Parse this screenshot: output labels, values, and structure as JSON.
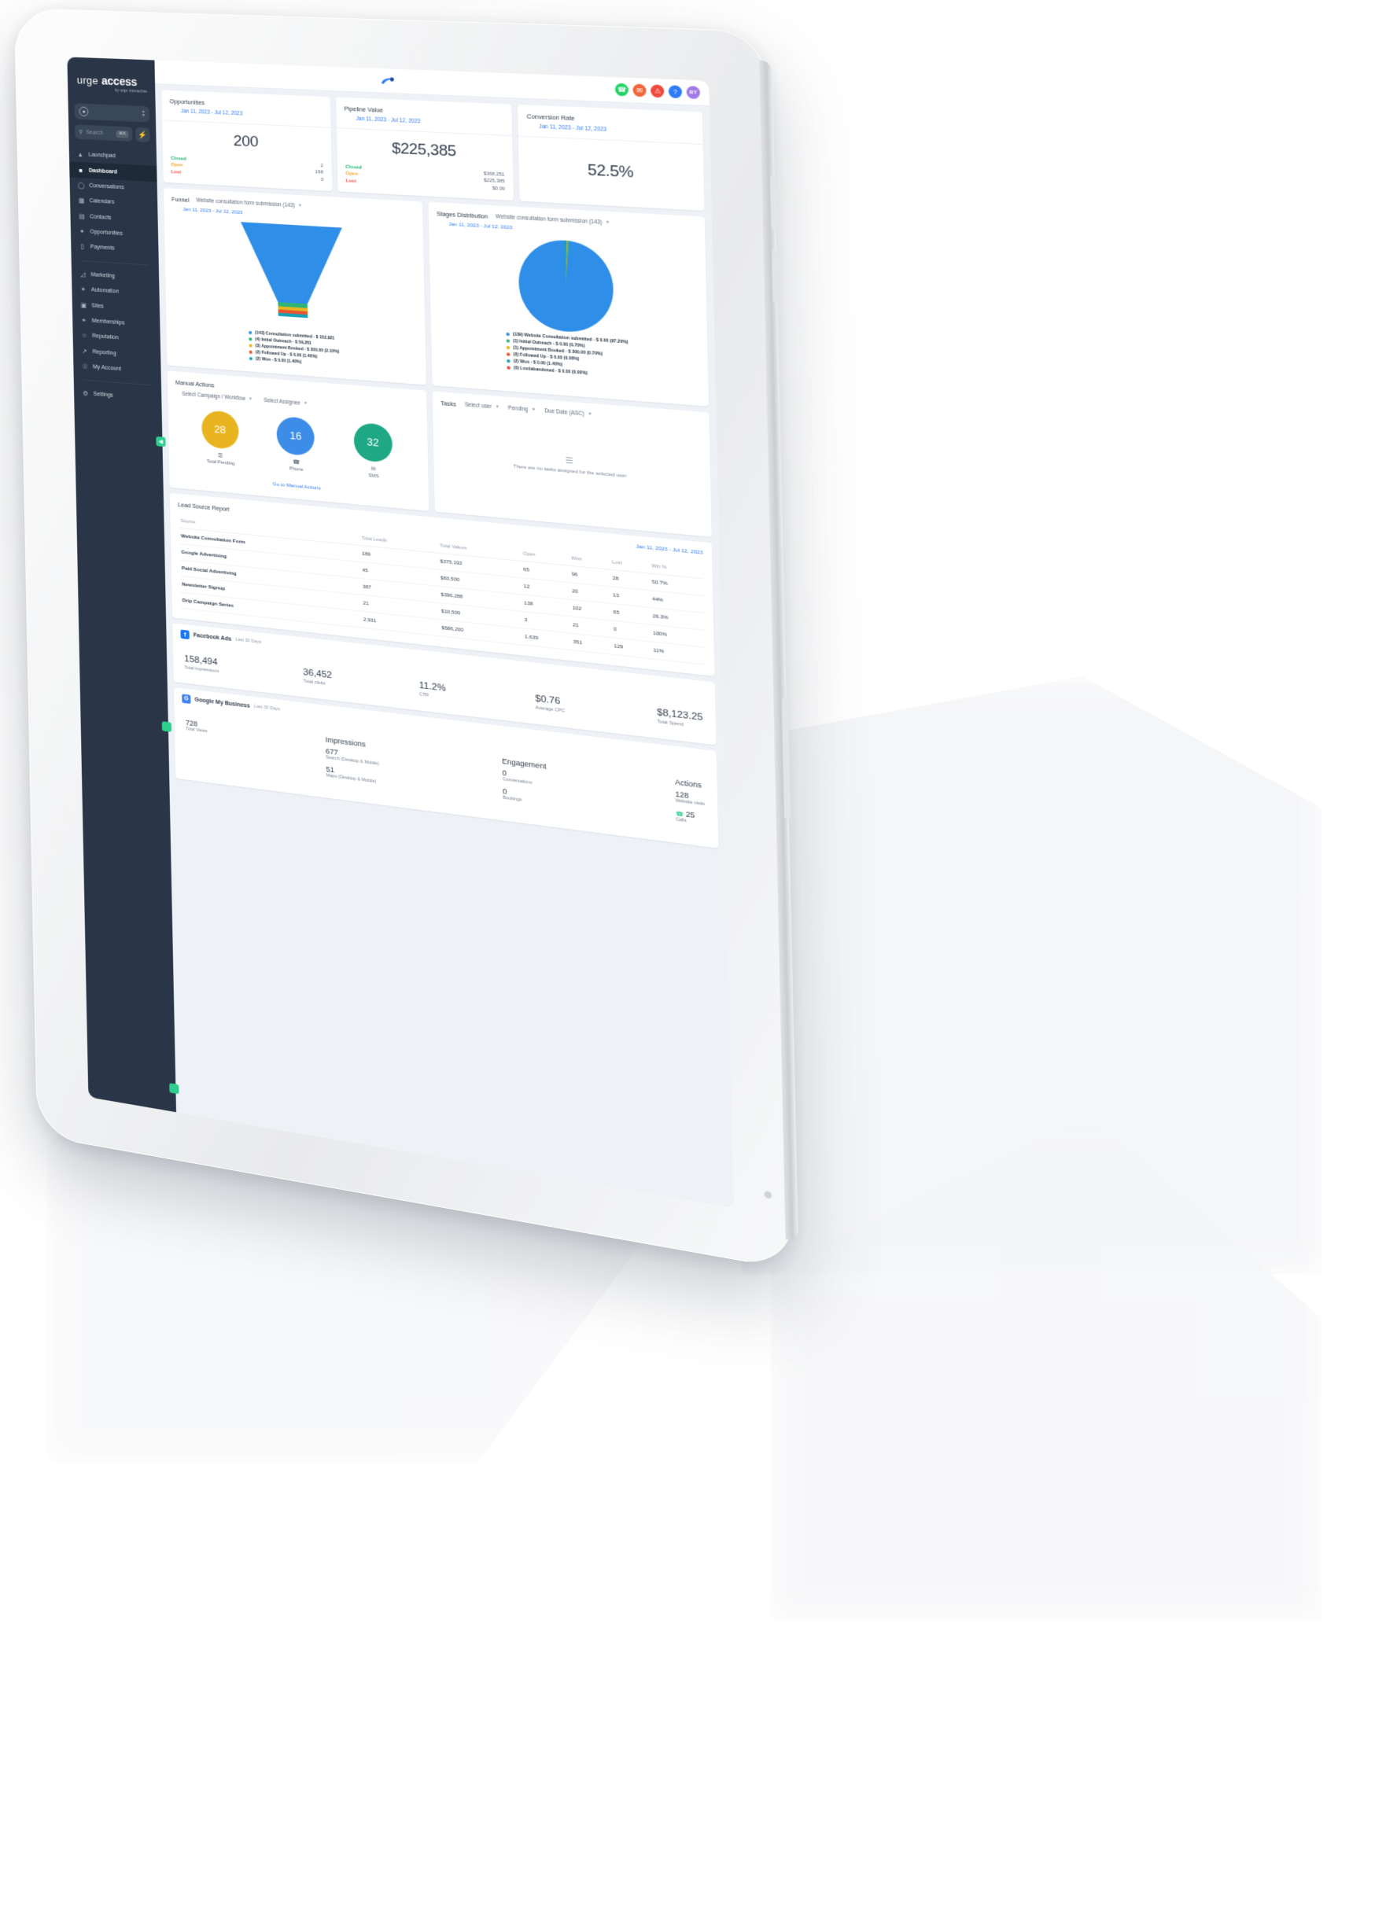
{
  "brand": {
    "name_part1": "urge",
    "name_part2": "access",
    "tagline": "by urge interactive"
  },
  "sidebar": {
    "search_placeholder": "Search",
    "search_shortcut": "⌘K",
    "items": [
      {
        "label": "Launchpad",
        "icon": "rocket-icon"
      },
      {
        "label": "Dashboard",
        "icon": "grid-icon"
      },
      {
        "label": "Conversations",
        "icon": "chat-icon"
      },
      {
        "label": "Calendars",
        "icon": "calendar-icon"
      },
      {
        "label": "Contacts",
        "icon": "contacts-icon"
      },
      {
        "label": "Opportunities",
        "icon": "opportunities-icon"
      },
      {
        "label": "Payments",
        "icon": "payments-icon"
      }
    ],
    "items2": [
      {
        "label": "Marketing",
        "icon": "megaphone-icon"
      },
      {
        "label": "Automation",
        "icon": "automation-icon"
      },
      {
        "label": "Sites",
        "icon": "sites-icon"
      },
      {
        "label": "Memberships",
        "icon": "memberships-icon"
      },
      {
        "label": "Reputation",
        "icon": "star-icon"
      },
      {
        "label": "Reporting",
        "icon": "reporting-icon"
      },
      {
        "label": "My Account",
        "icon": "account-icon"
      }
    ],
    "items3": [
      {
        "label": "Settings",
        "icon": "gear-icon"
      }
    ],
    "active": "Dashboard"
  },
  "topbar": {
    "avatar_initials": "BY"
  },
  "kpis": [
    {
      "title": "Opportunities",
      "date": "Jan 11, 2023 - Jul 12, 2023",
      "value": "200",
      "stats": [
        {
          "label": "Closed",
          "value": "2"
        },
        {
          "label": "Open",
          "value": "198"
        },
        {
          "label": "Lost",
          "value": "0"
        }
      ]
    },
    {
      "title": "Pipeline Value",
      "date": "Jan 11, 2023 - Jul 12, 2023",
      "value": "$225,385",
      "stats": [
        {
          "label": "Closed",
          "value": "$368,251"
        },
        {
          "label": "Open",
          "value": "$225,385"
        },
        {
          "label": "Lost",
          "value": "$0.00"
        }
      ]
    },
    {
      "title": "Conversion Rate",
      "date": "Jan 11, 2023 - Jul 12, 2023",
      "value": "52.5%",
      "stats": []
    }
  ],
  "funnel": {
    "title": "Funnel",
    "selector": "Website consultation form submission (143)",
    "date": "Jan 11, 2023 - Jul 12, 2023"
  },
  "stages": {
    "title": "Stages Distribution",
    "selector": "Website consultation form submission (143)",
    "date": "Jan 11, 2023 - Jul 12, 2023"
  },
  "manual_actions": {
    "title": "Manual Actions",
    "campaign_dropdown": "Select Campaign / Workflow",
    "assignee_dropdown": "Select Assignee",
    "link": "Go to Manual Actions",
    "circles": [
      {
        "value": "28",
        "label": "Total Pending",
        "icon": "list-icon",
        "color": "#e8b520"
      },
      {
        "value": "16",
        "label": "Phone",
        "icon": "phone-icon",
        "color": "#3b8de8"
      },
      {
        "value": "32",
        "label": "SMS",
        "icon": "sms-icon",
        "color": "#1fa886"
      }
    ]
  },
  "tasks": {
    "title": "Tasks",
    "user_dropdown": "Select user",
    "status_dropdown": "Pending",
    "sort_dropdown": "Due Date (ASC)",
    "empty_text": "There are no tasks assigned for the selected user"
  },
  "lead_source": {
    "title": "Lead Source Report",
    "date": "Jan 11, 2023 - Jul 12, 2023",
    "columns": [
      "Source",
      "Total Leads",
      "Total Values",
      "Open",
      "Won",
      "Lost",
      "Win %"
    ],
    "rows": [
      [
        "Website Consultation Form",
        "189",
        "$375,193",
        "65",
        "96",
        "28",
        "50.7%"
      ],
      [
        "Google Advertising",
        "45",
        "$83,500",
        "12",
        "20",
        "13",
        "44%"
      ],
      [
        "Paid Social Advertising",
        "387",
        "$396,288",
        "138",
        "102",
        "65",
        "26.3%"
      ],
      [
        "Newsletter Signup",
        "21",
        "$10,500",
        "3",
        "21",
        "0",
        "100%"
      ],
      [
        "Drip Campaign Series",
        "2,931",
        "$586,200",
        "1,639",
        "351",
        "129",
        "11%"
      ]
    ]
  },
  "facebook": {
    "title": "Facebook Ads",
    "subtitle": "Last 30 Days",
    "stats": [
      {
        "value": "158,494",
        "label": "Total impressions"
      },
      {
        "value": "36,452",
        "label": "Total clicks"
      },
      {
        "value": "11.2%",
        "label": "CTR"
      },
      {
        "value": "$0.76",
        "label": "Average CPC"
      },
      {
        "value": "$8,123.25",
        "label": "Total Spend"
      }
    ]
  },
  "gmb": {
    "title": "Google My Business",
    "subtitle": "Last 30 Days",
    "total_views_value": "728",
    "total_views_label": "Total Views",
    "impressions_header": "Impressions",
    "impressions": [
      {
        "value": "677",
        "label": "Search (Desktop & Mobile)"
      },
      {
        "value": "51",
        "label": "Maps (Desktop & Mobile)"
      }
    ],
    "engagement_header": "Engagement",
    "engagement": [
      {
        "value": "0",
        "label": "Conversations"
      },
      {
        "value": "0",
        "label": "Bookings"
      }
    ],
    "actions_header": "Actions",
    "actions": [
      {
        "value": "128",
        "label": "Website visits"
      },
      {
        "value": "25",
        "label": "Calls"
      }
    ]
  },
  "chart_data": [
    {
      "type": "funnel",
      "title": "Funnel",
      "legend_position": "bottom",
      "categories": [
        "(143) Consultation submitted",
        "(4) Initial Outreach",
        "(3) Appointment Booked",
        "(2) Followed Up",
        "(2) Won"
      ],
      "counts": [
        143,
        4,
        3,
        2,
        2
      ],
      "values": [
        "$ 152,921",
        "$ 59,261",
        "$ 300.00",
        "$ 0.00",
        "$ 0.00"
      ],
      "percents": [
        null,
        null,
        "2.10%",
        "1.40%",
        "1.40%"
      ],
      "colors": [
        "#2f8fe8",
        "#2fb673",
        "#e8b520",
        "#e8562f",
        "#17a2b8"
      ],
      "labels": [
        "(143) Consultation submitted - $ 152,921",
        "(4) Initial Outreach - $ 59,261",
        "(3) Appointment Booked - $ 300.00 (2.10%)",
        "(2) Followed Up - $ 0.00 (1.40%)",
        "(2) Won - $ 0.00 (1.40%)"
      ]
    },
    {
      "type": "pie",
      "title": "Stages Distribution",
      "legend_position": "bottom",
      "categories": [
        "(139) Website Consultation submitted",
        "(1) Initial Outreach",
        "(1) Appointment Booked",
        "(0) Followed Up",
        "(2) Won",
        "(0) Lost/abandoned"
      ],
      "values": [
        97.2,
        0.7,
        0.7,
        0.0,
        1.4,
        0.0
      ],
      "colors": [
        "#2f8fe8",
        "#2fb673",
        "#e8b520",
        "#e8562f",
        "#17a2b8",
        "#f0493e"
      ],
      "labels": [
        "(139) Website Consultation submitted - $ 0.00 (97.20%)",
        "(1) Initial Outreach - $ 0.00 (0.70%)",
        "(1) Appointment Booked - $ 300.00 (0.70%)",
        "(0) Followed Up - $ 0.00 (0.00%)",
        "(2) Won - $ 0.00 (1.40%)",
        "(0) Lost/abandoned - $ 0.00 (0.00%)"
      ]
    },
    {
      "type": "table",
      "title": "Lead Source Report",
      "columns": [
        "Source",
        "Total Leads",
        "Total Values",
        "Open",
        "Won",
        "Lost",
        "Win %"
      ],
      "rows": [
        [
          "Website Consultation Form",
          "189",
          "$375,193",
          "65",
          "96",
          "28",
          "50.7%"
        ],
        [
          "Google Advertising",
          "45",
          "$83,500",
          "12",
          "20",
          "13",
          "44%"
        ],
        [
          "Paid Social Advertising",
          "387",
          "$396,288",
          "138",
          "102",
          "65",
          "26.3%"
        ],
        [
          "Newsletter Signup",
          "21",
          "$10,500",
          "3",
          "21",
          "0",
          "100%"
        ],
        [
          "Drip Campaign Series",
          "2,931",
          "$586,200",
          "1,639",
          "351",
          "129",
          "11%"
        ]
      ]
    }
  ]
}
